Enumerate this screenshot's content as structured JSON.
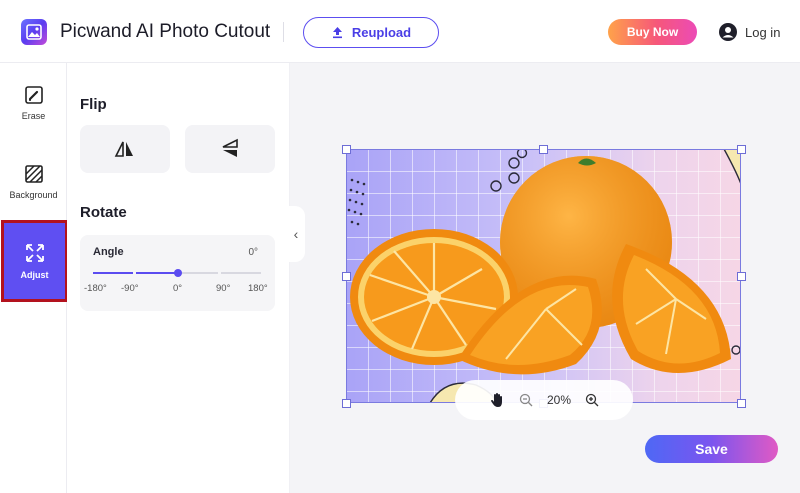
{
  "header": {
    "app_title": "Picwand AI Photo Cutout",
    "reupload_label": "Reupload",
    "buy_now_label": "Buy Now",
    "login_label": "Log in"
  },
  "tools": [
    {
      "label": "Erase",
      "icon": "eraser-icon"
    },
    {
      "label": "Background",
      "icon": "background-pattern-icon"
    },
    {
      "label": "Adjust",
      "icon": "expand-arrows-icon",
      "active": true
    }
  ],
  "panel": {
    "flip_title": "Flip",
    "rotate_title": "Rotate",
    "angle_label": "Angle",
    "angle_value": "0°",
    "angle_slider_value": 0,
    "angle_ticks": [
      "-180°",
      "-90°",
      "0°",
      "90°",
      "180°"
    ]
  },
  "canvas": {
    "zoom_value": "20%"
  },
  "save_label": "Save",
  "colors": {
    "accent": "#5f4ff2",
    "active_outline": "#b3121e",
    "buy_now_gradient_start": "#ffa24a",
    "buy_now_gradient_end": "#ec4bb6"
  }
}
